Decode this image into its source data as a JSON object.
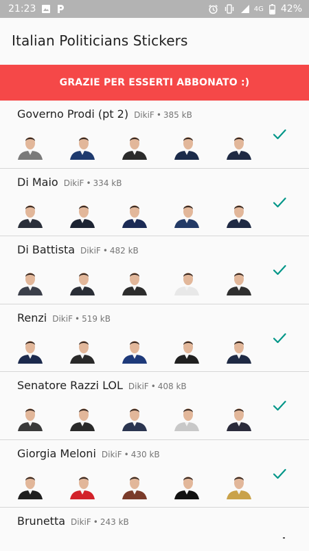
{
  "status_bar": {
    "time": "21:23",
    "network": "4G",
    "battery": "42%",
    "left_icons": [
      "image-icon",
      "parking-icon"
    ],
    "right_icons": [
      "alarm-icon",
      "vibrate-icon",
      "signal-icon",
      "battery-icon"
    ]
  },
  "app": {
    "title": "Italian Politicians Stickers"
  },
  "banner": {
    "text": "GRAZIE PER ESSERTI ABBONATO :)",
    "color": "#f54848"
  },
  "packs": [
    {
      "name": "Governo Prodi (pt 2)",
      "author": "DikiF",
      "size": "385 kB",
      "added": true,
      "sticker_colors": [
        "#7a7a7a",
        "#1e3a6e",
        "#2b2b2b",
        "#1b2b4a",
        "#1f2a44"
      ]
    },
    {
      "name": "Di Maio",
      "author": "DikiF",
      "size": "334 kB",
      "added": true,
      "sticker_colors": [
        "#2a2f3a",
        "#1d2433",
        "#1b2b55",
        "#233a66",
        "#1f2a44"
      ]
    },
    {
      "name": "Di Battista",
      "author": "DikiF",
      "size": "482 kB",
      "added": true,
      "sticker_colors": [
        "#3b3f4a",
        "#2a2e36",
        "#2d2d2d",
        "#e8e8e8",
        "#2f2f2f"
      ]
    },
    {
      "name": "Renzi",
      "author": "DikiF",
      "size": "519 kB",
      "added": true,
      "sticker_colors": [
        "#1c2a4d",
        "#2a2a2a",
        "#1e3a7a",
        "#202020",
        "#1f2a44"
      ]
    },
    {
      "name": "Senatore Razzi LOL",
      "author": "DikiF",
      "size": "408 kB",
      "added": true,
      "sticker_colors": [
        "#3a3a3a",
        "#2a2a2a",
        "#2b3550",
        "#c8c8c8",
        "#2b2b3b"
      ]
    },
    {
      "name": "Giorgia Meloni",
      "author": "DikiF",
      "size": "430 kB",
      "added": true,
      "sticker_colors": [
        "#1f1f1f",
        "#d2222a",
        "#7a3b2a",
        "#111111",
        "#c9a24a"
      ]
    },
    {
      "name": "Brunetta",
      "author": "DikiF",
      "size": "243 kB",
      "added": false,
      "sticker_colors": []
    }
  ],
  "theme": {
    "check_color": "#009688",
    "divider": "#d6d6d6"
  }
}
